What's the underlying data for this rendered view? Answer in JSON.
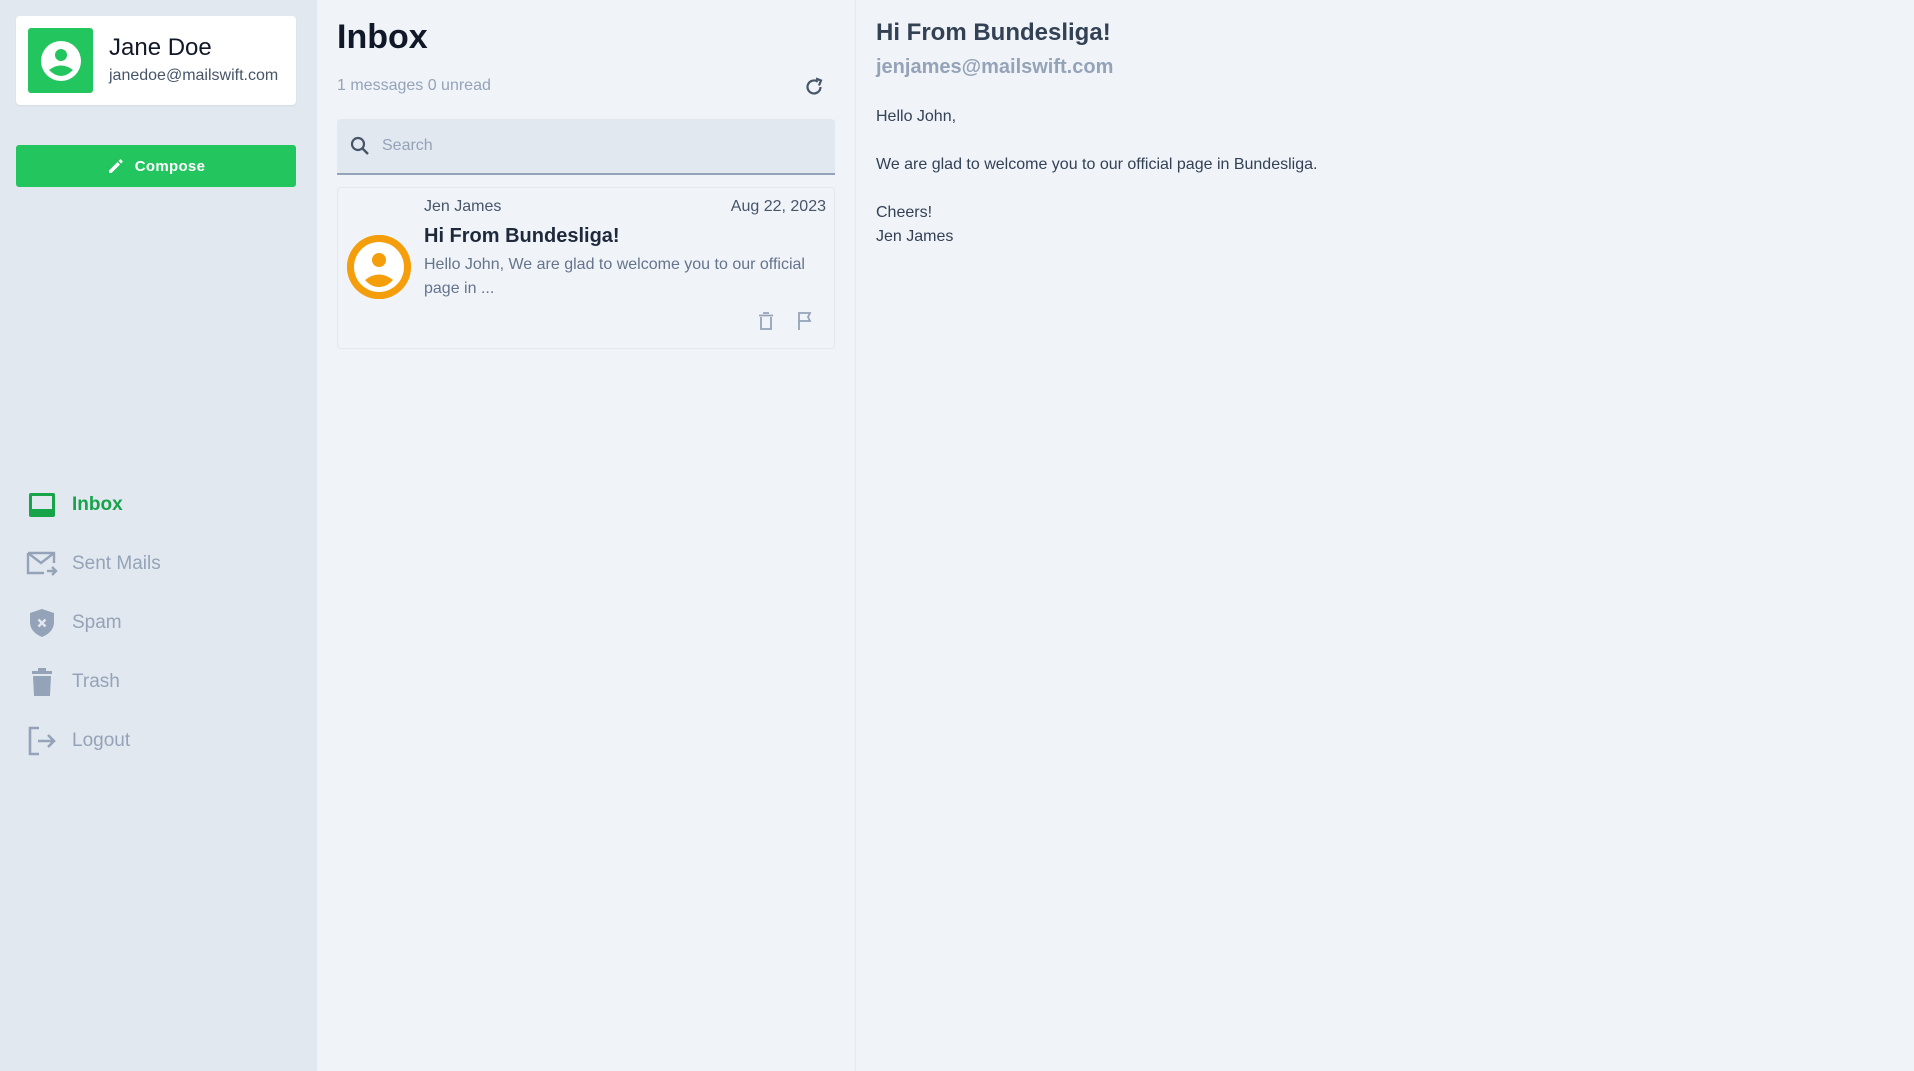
{
  "user": {
    "name": "Jane Doe",
    "email": "janedoe@mailswift.com",
    "avatar_icon": "user-circle-icon",
    "avatar_color": "#22c55e"
  },
  "compose": {
    "label": "Compose",
    "icon": "pencil-icon",
    "color": "#22c55e"
  },
  "nav": {
    "items": [
      {
        "label": "Inbox",
        "icon": "inbox-icon",
        "active": true
      },
      {
        "label": "Sent Mails",
        "icon": "sent-mail-icon",
        "active": false
      },
      {
        "label": "Spam",
        "icon": "shield-x-icon",
        "active": false
      },
      {
        "label": "Trash",
        "icon": "trash-icon",
        "active": false
      },
      {
        "label": "Logout",
        "icon": "logout-icon",
        "active": false
      }
    ],
    "active_color": "#16a34a",
    "inactive_color": "#94a3b8"
  },
  "list": {
    "title": "Inbox",
    "count_text": "1 messages 0 unread",
    "search": {
      "placeholder": "Search",
      "value": ""
    },
    "messages": [
      {
        "sender": "Jen James",
        "date": "Aug 22, 2023",
        "subject": "Hi From Bundesliga!",
        "preview": "Hello John, We are glad to welcome you to our official page in ...",
        "avatar_color": "#f59e0b"
      }
    ]
  },
  "reader": {
    "subject": "Hi From Bundesliga!",
    "from": "jenjames@mailswift.com",
    "greeting": "Hello John,",
    "body": "We are glad to welcome you to our official page in Bundesliga.",
    "signoff": "Cheers!",
    "signature": "Jen James"
  }
}
